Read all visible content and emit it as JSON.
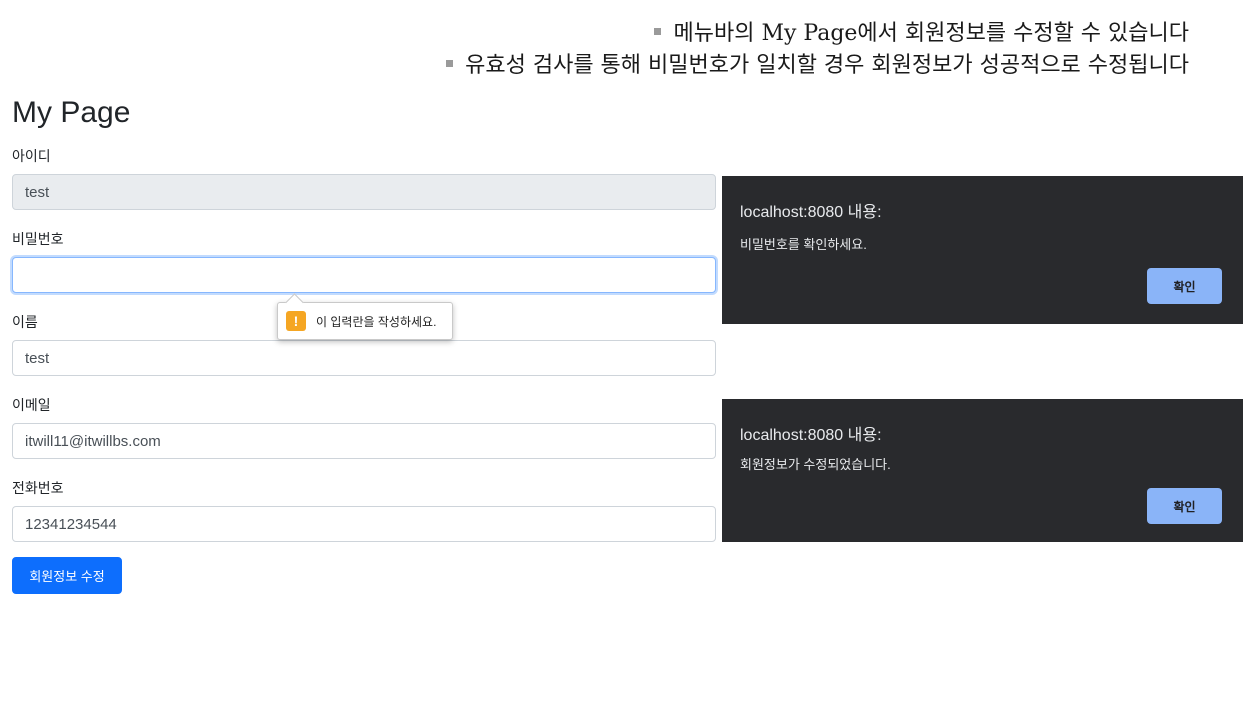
{
  "notes": [
    "메뉴바의 My Page에서 회원정보를 수정할 수 있습니다",
    "유효성 검사를 통해 비밀번호가 일치할 경우 회원정보가 성공적으로 수정됩니다"
  ],
  "page_title": "My Page",
  "form": {
    "id_label": "아이디",
    "id_value": "test",
    "password_label": "비밀번호",
    "password_value": "",
    "name_label": "이름",
    "name_value": "test",
    "email_label": "이메일",
    "email_value": "itwill11@itwillbs.com",
    "phone_label": "전화번호",
    "phone_value": "12341234544",
    "submit_label": "회원정보 수정"
  },
  "validation_tooltip": {
    "icon": "warning-icon",
    "icon_glyph": "!",
    "text": "이 입력란을 작성하세요."
  },
  "dialogs": [
    {
      "title": "localhost:8080 내용:",
      "message": "비밀번호를 확인하세요.",
      "button": "확인"
    },
    {
      "title": "localhost:8080 내용:",
      "message": "회원정보가 수정되었습니다.",
      "button": "확인"
    }
  ],
  "colors": {
    "primary": "#0d6efd",
    "dialog_bg": "#292a2d",
    "dialog_button": "#8ab4f8",
    "warning": "#f5a623",
    "readonly_bg": "#e9ecef"
  }
}
